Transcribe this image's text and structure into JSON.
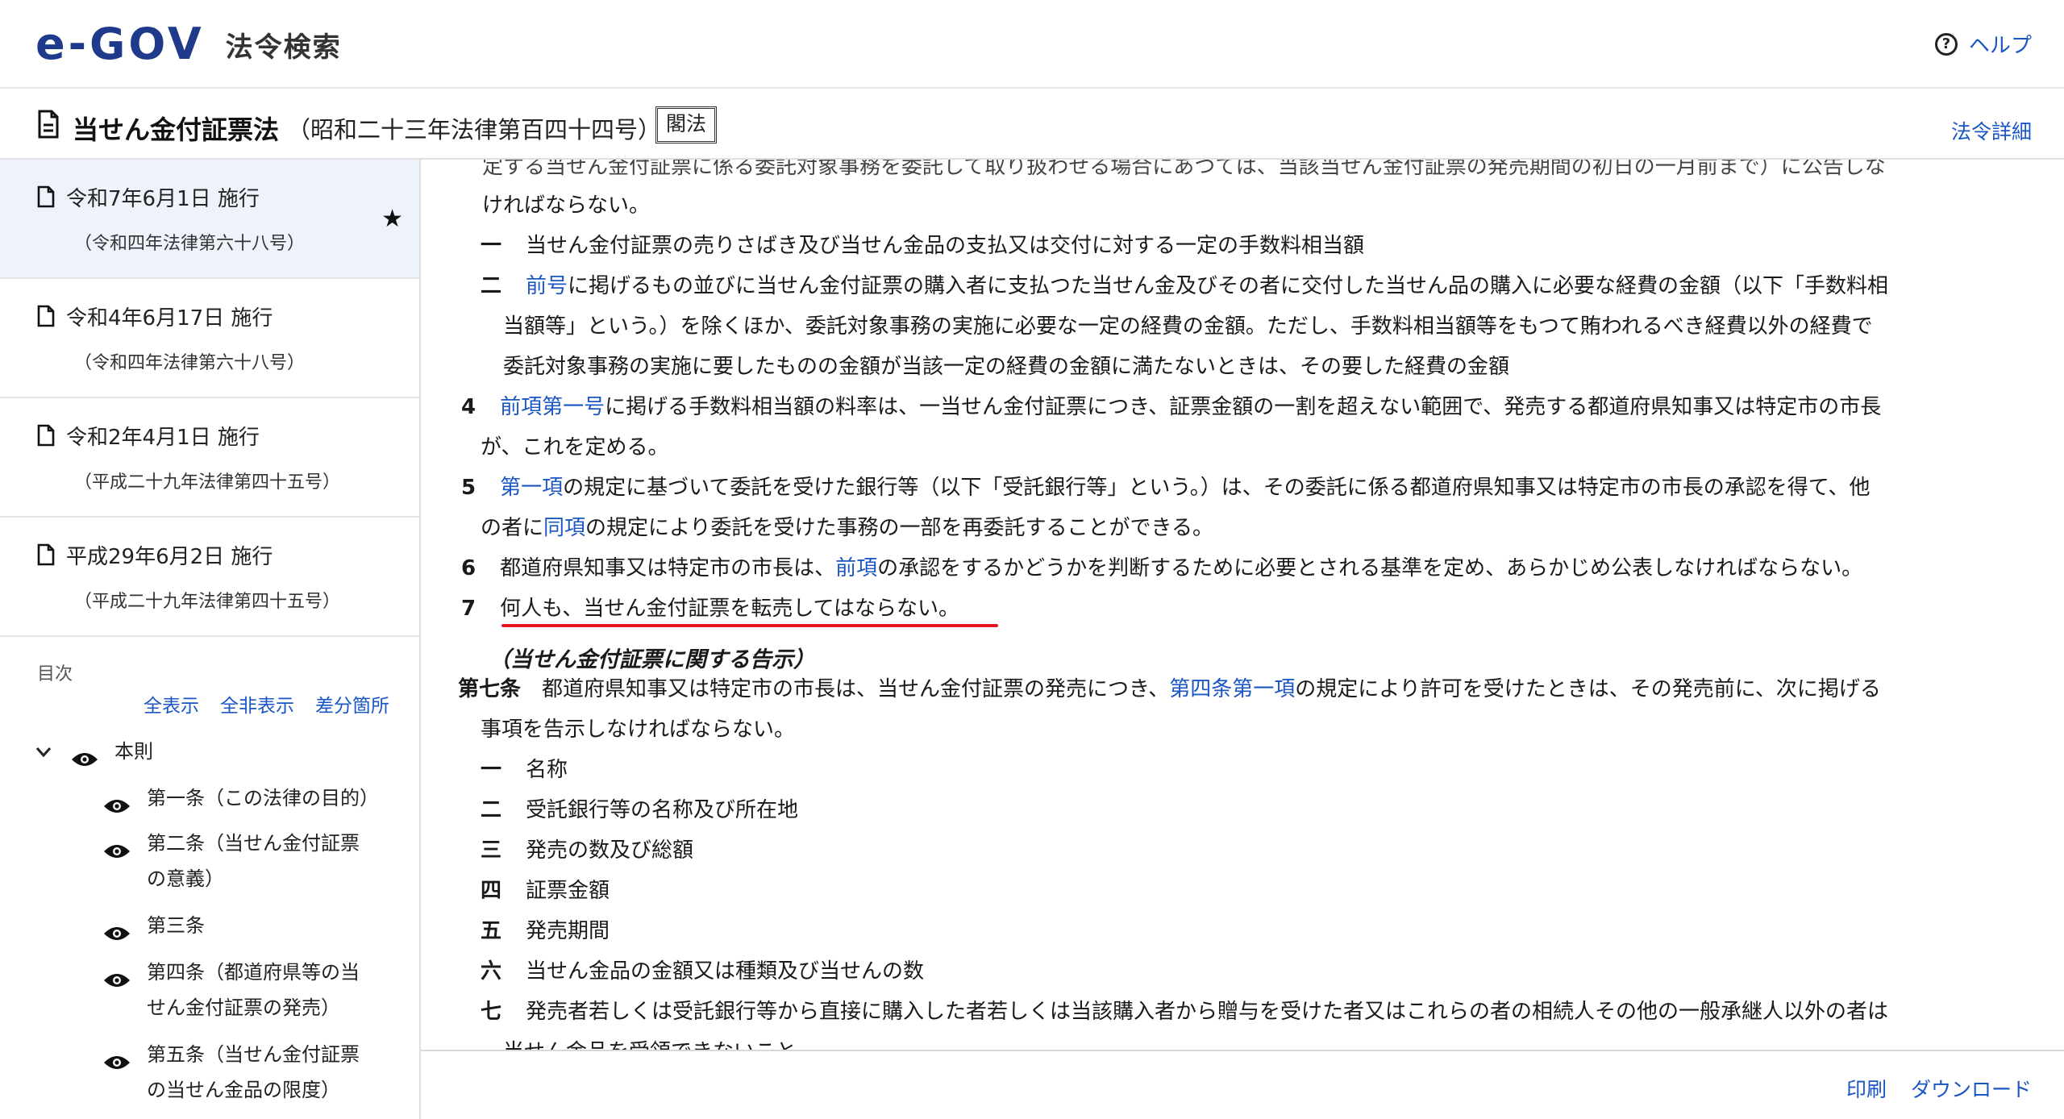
{
  "header": {
    "logo_text": "e-GOV",
    "site_title": "法令検索",
    "help_label": "ヘルプ"
  },
  "law": {
    "title": "当せん金付証票法",
    "number": "（昭和二十三年法律第百四十四号）",
    "badge": "閣法",
    "detail_label": "法令詳細"
  },
  "versions": [
    {
      "date": "令和7年6月1日 施行",
      "law": "（令和四年法律第六十八号）",
      "selected": true
    },
    {
      "date": "令和4年6月17日 施行",
      "law": "（令和四年法律第六十八号）",
      "selected": false
    },
    {
      "date": "令和2年4月1日 施行",
      "law": "（平成二十九年法律第四十五号）",
      "selected": false
    },
    {
      "date": "平成29年6月2日 施行",
      "law": "（平成二十九年法律第四十五号）",
      "selected": false
    }
  ],
  "toc": {
    "label": "目次",
    "links": [
      "全表示",
      "全非表示",
      "差分箇所"
    ],
    "root": "本則",
    "items": [
      [
        "第一条（この法律の目的）"
      ],
      [
        "第二条（当せん金付証票",
        "の意義）"
      ],
      [
        "第三条"
      ],
      [
        "第四条（都道府県等の当",
        "せん金付証票の発売）"
      ],
      [
        "第五条（当せん金付証票",
        "の当せん金品の限度）"
      ]
    ]
  },
  "content": {
    "l0": "定する当せん金付証票に係る委託対象事務を委託して取り扱わせる場合にあつては、当該当せん金付証票の発売期間の初日の一月前まで）に公告しな",
    "l1": "ければならない。",
    "i1_num": "一",
    "i1_text": "当せん金付証票の売りさばき及び当せん金品の支払又は交付に対する一定の手数料相当額",
    "i2_num": "二",
    "i2_link": "前号",
    "i2_text1": "に掲げるもの並びに当せん金付証票の購入者に支払つた当せん金及びその者に交付した当せん品の購入に必要な経費の金額（以下「手数料相",
    "i2_text2": "当額等」という。）を除くほか、委託対象事務の実施に必要な一定の経費の金額。ただし、手数料相当額等をもつて賄われるべき経費以外の経費で",
    "i2_text3": "委託対象事務の実施に要したものの金額が当該一定の経費の金額に満たないときは、その要した経費の金額",
    "p4_num": "4",
    "p4_link": "前項第一号",
    "p4_text1": "に掲げる手数料相当額の料率は、一当せん金付証票につき、証票金額の一割を超えない範囲で、発売する都道府県知事又は特定市の市長",
    "p4_text2": "が、これを定める。",
    "p5_num": "5",
    "p5_link1": "第一項",
    "p5_text1": "の規定に基づいて委託を受けた銀行等（以下「受託銀行等」という。）は、その委託に係る都道府県知事又は特定市の市長の承認を得て、他",
    "p5_text2a": "の者に",
    "p5_link2": "同項",
    "p5_text2b": "の規定により委託を受けた事務の一部を再委託することができる。",
    "p6_num": "6",
    "p6_text_a": "都道府県知事又は特定市の市長は、",
    "p6_link": "前項",
    "p6_text_b": "の承認をするかどうかを判断するために必要とされる基準を定め、あらかじめ公表しなければならない。",
    "p7_num": "7",
    "p7_text": "何人も、当せん金付証票を転売してはならない。",
    "a7_caption": "（当せん金付証票に関する告示）",
    "a7_num": "第七条",
    "a7_text_a": "都道府県知事又は特定市の市長は、当せん金付証票の発売につき、",
    "a7_link": "第四条第一項",
    "a7_text_b": "の規定により許可を受けたときは、その発売前に、次に掲げる",
    "a7_text2": "事項を告示しなければならない。",
    "a7_items": [
      {
        "num": "一",
        "text": "名称"
      },
      {
        "num": "二",
        "text": "受託銀行等の名称及び所在地"
      },
      {
        "num": "三",
        "text": "発売の数及び総額"
      },
      {
        "num": "四",
        "text": "証票金額"
      },
      {
        "num": "五",
        "text": "発売期間"
      },
      {
        "num": "六",
        "text": "当せん金品の金額又は種類及び当せんの数"
      },
      {
        "num": "七",
        "text": "発売者若しくは受託銀行等から直接に購入した者若しくは当該購入者から贈与を受けた者又はこれらの者の相続人その他の一般承継人以外の者は"
      }
    ],
    "a7_last": "当せん金品を受領できないこと"
  },
  "footer": {
    "print_label": "印刷",
    "download_label": "ダウンロード"
  },
  "colors": {
    "link": "#1a56c4",
    "selected_bg": "#eef3fb",
    "underline": "#e0181e"
  }
}
